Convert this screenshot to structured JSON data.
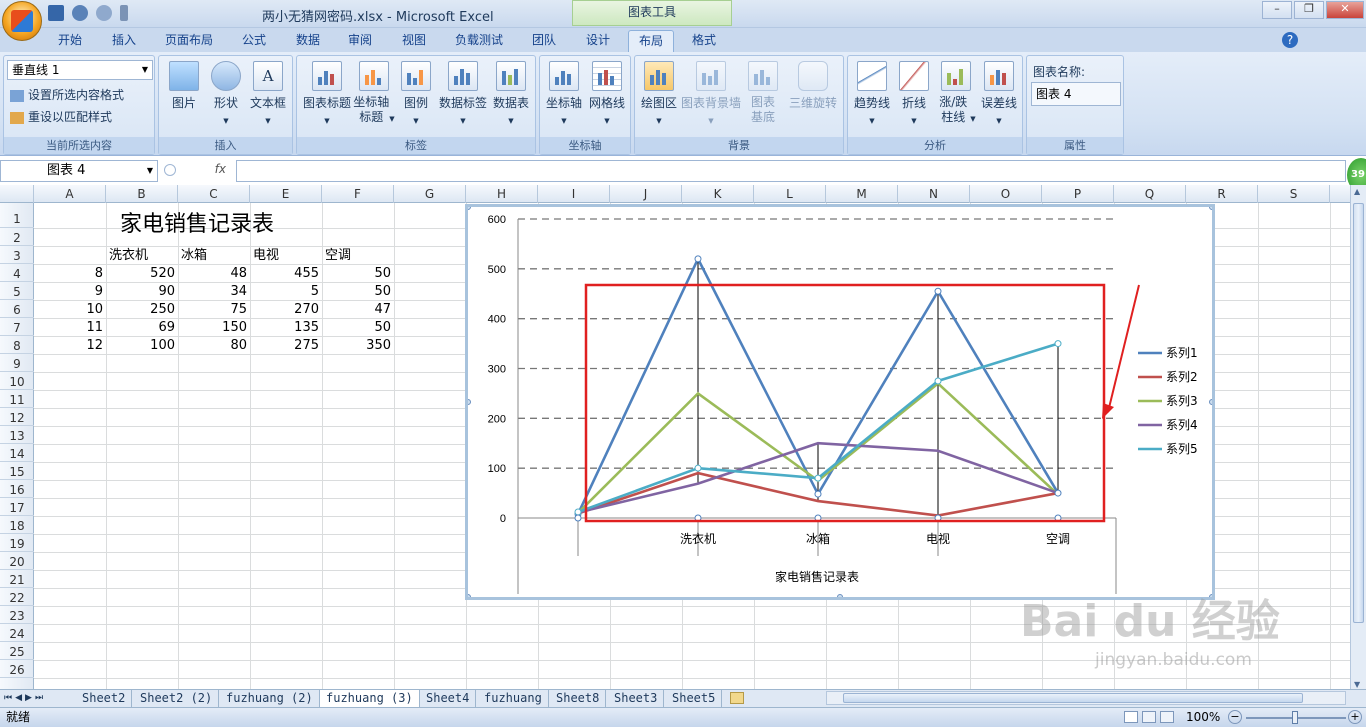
{
  "window": {
    "title": "两小无猜网密码.xlsx - Microsoft Excel",
    "context_tab": "图表工具"
  },
  "ribbon_tabs": [
    "开始",
    "插入",
    "页面布局",
    "公式",
    "数据",
    "审阅",
    "视图",
    "负载测试",
    "团队",
    "设计",
    "布局",
    "格式"
  ],
  "ribbon": {
    "current_selection": {
      "dropdown": "垂直线 1",
      "format_btn": "设置所选内容格式",
      "reset_btn": "重设以匹配样式",
      "title": "当前所选内容"
    },
    "insert": {
      "title": "插入",
      "buttons": [
        "图片",
        "形状",
        "文本框"
      ]
    },
    "labels": {
      "title": "标签",
      "buttons": [
        "图表标题",
        "坐标轴标题",
        "图例",
        "数据标签",
        "数据表"
      ]
    },
    "axes": {
      "title": "坐标轴",
      "buttons": [
        "坐标轴",
        "网格线"
      ]
    },
    "background": {
      "title": "背景",
      "buttons": [
        "绘图区",
        "图表背景墙",
        "图表基底",
        "三维旋转"
      ]
    },
    "analysis": {
      "title": "分析",
      "buttons": [
        "趋势线",
        "折线",
        "涨/跌柱线",
        "误差线"
      ]
    },
    "properties": {
      "title": "属性",
      "label": "图表名称:",
      "value": "图表 4"
    }
  },
  "namebox": "图表 4",
  "fx": "fx",
  "columns": [
    "A",
    "B",
    "C",
    "E",
    "F",
    "G",
    "H",
    "I",
    "J",
    "K",
    "L",
    "M",
    "N",
    "O",
    "P",
    "Q",
    "R",
    "S"
  ],
  "rows": [
    "1",
    "2",
    "3",
    "4",
    "5",
    "6",
    "7",
    "8",
    "9",
    "10",
    "11",
    "12",
    "13",
    "14",
    "15",
    "16",
    "17",
    "18",
    "19",
    "20",
    "21",
    "22",
    "23",
    "24",
    "25",
    "26"
  ],
  "sheet": {
    "title": "家电销售记录表",
    "headers": [
      "洗衣机",
      "冰箱",
      "电视",
      "空调"
    ],
    "data": [
      [
        "8",
        "520",
        "48",
        "455",
        "50"
      ],
      [
        "9",
        "90",
        "34",
        "5",
        "50"
      ],
      [
        "10",
        "250",
        "75",
        "270",
        "47"
      ],
      [
        "11",
        "69",
        "150",
        "135",
        "50"
      ],
      [
        "12",
        "100",
        "80",
        "275",
        "350"
      ]
    ]
  },
  "chart_data": {
    "type": "line",
    "x_title": "家电销售记录表",
    "categories": [
      "",
      "洗衣机",
      "冰箱",
      "电视",
      "空调"
    ],
    "ylim": [
      0,
      600
    ],
    "yticks": [
      "0",
      "100",
      "200",
      "300",
      "400",
      "500",
      "600"
    ],
    "legend_position": "right",
    "series": [
      {
        "name": "系列1",
        "values": [
          8,
          520,
          48,
          455,
          50
        ],
        "color": "#4f81bd"
      },
      {
        "name": "系列2",
        "values": [
          9,
          90,
          34,
          5,
          50
        ],
        "color": "#c0504d"
      },
      {
        "name": "系列3",
        "values": [
          10,
          250,
          75,
          270,
          47
        ],
        "color": "#9bbb59"
      },
      {
        "name": "系列4",
        "values": [
          11,
          69,
          150,
          135,
          50
        ],
        "color": "#8064a2"
      },
      {
        "name": "系列5",
        "values": [
          12,
          100,
          80,
          275,
          350
        ],
        "color": "#4bacc6"
      }
    ],
    "highlight_color": "#e02020"
  },
  "sheet_tabs": [
    "Sheet2",
    "Sheet2 (2)",
    "fuzhuang (2)",
    "fuzhuang (3)",
    "Sheet4",
    "fuzhuang",
    "Sheet8",
    "Sheet3",
    "Sheet5"
  ],
  "active_sheet_index": 3,
  "status": {
    "ready": "就绪",
    "zoom": "100%"
  },
  "badge": "39",
  "watermark": {
    "main": "Bai du 经验",
    "url": "jingyan.baidu.com"
  }
}
